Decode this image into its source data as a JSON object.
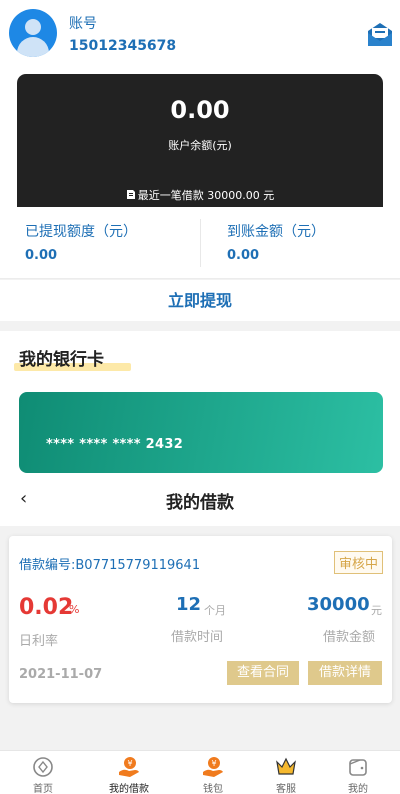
{
  "account": {
    "label": "账号",
    "phone": "15012345678"
  },
  "balance": {
    "amount": "0.00",
    "label": "账户余额(元)",
    "last_loan": "最近一笔借款 30000.00 元"
  },
  "stats": {
    "withdrawn_label": "已提现额度（元）",
    "withdrawn_value": "0.00",
    "received_label": "到账金额（元）",
    "received_value": "0.00"
  },
  "withdraw_button": "立即提现",
  "bank_cards": {
    "title": "我的银行卡",
    "card_number": "**** **** **** 2432"
  },
  "loans": {
    "title": "我的借款",
    "back_icon": "‹",
    "items": [
      {
        "id_label": "借款编号:B07715779119641",
        "status": "审核中",
        "rate_value": "0.02",
        "rate_unit": "%",
        "rate_label": "日利率",
        "term_value": "12",
        "term_unit": "个月",
        "term_label": "借款时间",
        "amount_value": "30000",
        "amount_unit": "元",
        "amount_label": "借款金额",
        "date": "2021-11-07",
        "contract_button": "查看合同",
        "detail_button": "借款详情"
      }
    ]
  },
  "tabbar": [
    {
      "label": "首页",
      "icon": "home-icon"
    },
    {
      "label": "我的借款",
      "icon": "loan-icon"
    },
    {
      "label": "钱包",
      "icon": "wallet-icon"
    },
    {
      "label": "客服",
      "icon": "crown-icon"
    },
    {
      "label": "我的",
      "icon": "profile-icon"
    }
  ],
  "colors": {
    "primary": "#1e6fb5",
    "card_dark": "#222222",
    "accent_gold": "#dfc98c",
    "rate_red": "#e53935",
    "card_green": "#1aa589"
  }
}
